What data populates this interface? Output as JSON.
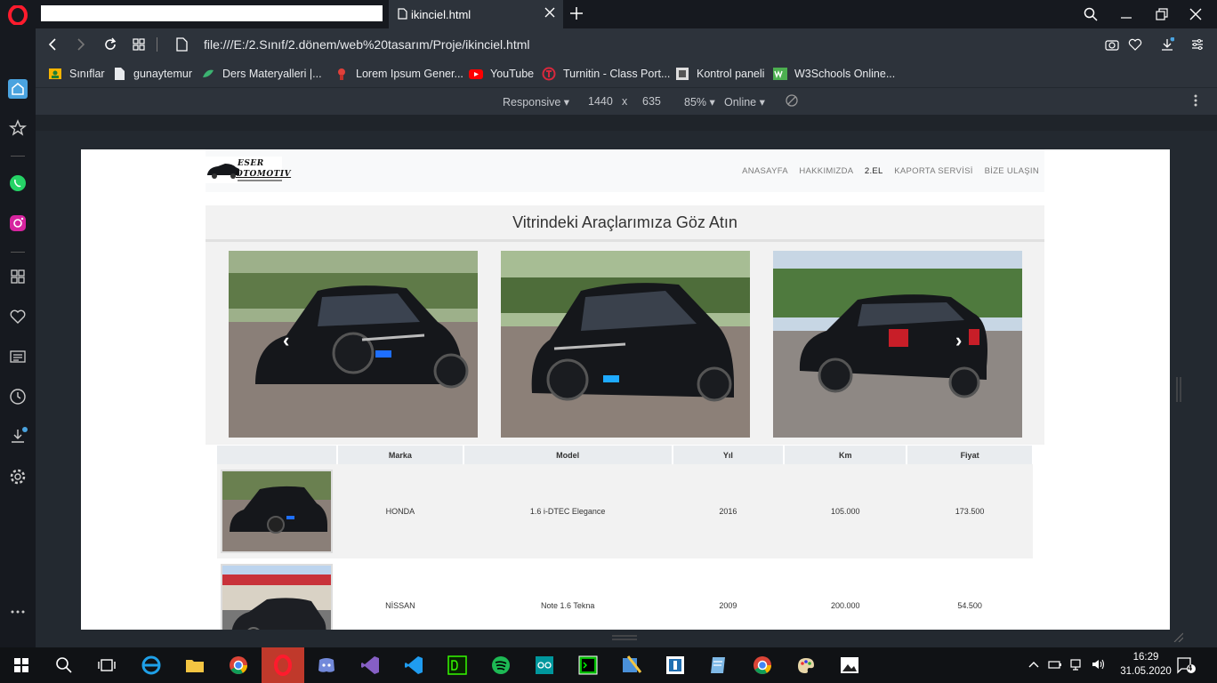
{
  "browser": {
    "tab_title": "ikinciel.html",
    "url": "file:///E:/2.Sınıf/2.dönem/web%20tasarım/Proje/ikinciel.html",
    "bookmarks": [
      "Sınıflar",
      "gunaytemur",
      "Ders Materyalleri |...",
      "Lorem Ipsum Gener...",
      "YouTube",
      "Turnitin - Class Port...",
      "Kontrol paneli",
      "W3Schools Online..."
    ],
    "devtools": {
      "mode": "Responsive",
      "width": "1440",
      "x": "x",
      "height": "635",
      "zoom": "85%",
      "network": "Online"
    }
  },
  "site": {
    "logo_line1": "ESER",
    "logo_line2": "OTOMOTIV",
    "nav": [
      "ANASAYFA",
      "HAKKIMIZDA",
      "2.EL",
      "KAPORTA SERVİSİ",
      "BİZE ULAŞIN"
    ],
    "active_nav": "2.EL",
    "showcase_title": "Vitrindeki Araçlarımıza Göz Atın",
    "carousel_prev": "‹",
    "carousel_next": "›",
    "table": {
      "headers": [
        "",
        "Marka",
        "Model",
        "Yıl",
        "Km",
        "Fiyat"
      ],
      "rows": [
        {
          "marka": "HONDA",
          "model": "1.6 i-DTEC Elegance",
          "yil": "2016",
          "km": "105.000",
          "fiyat": "173.500"
        },
        {
          "marka": "NİSSAN",
          "model": "Note 1.6 Tekna",
          "yil": "2009",
          "km": "200.000",
          "fiyat": "54.500"
        }
      ]
    }
  },
  "taskbar": {
    "time": "16:29",
    "date": "31.05.2020",
    "notification_count": "4"
  },
  "colors": {
    "chrome_dark": "#16191f",
    "chrome": "#2d333b",
    "opera_red": "#ff1b2d",
    "accent_blue": "#4aa3df",
    "car_black": "#15171b",
    "paving": "#8a7f78"
  }
}
